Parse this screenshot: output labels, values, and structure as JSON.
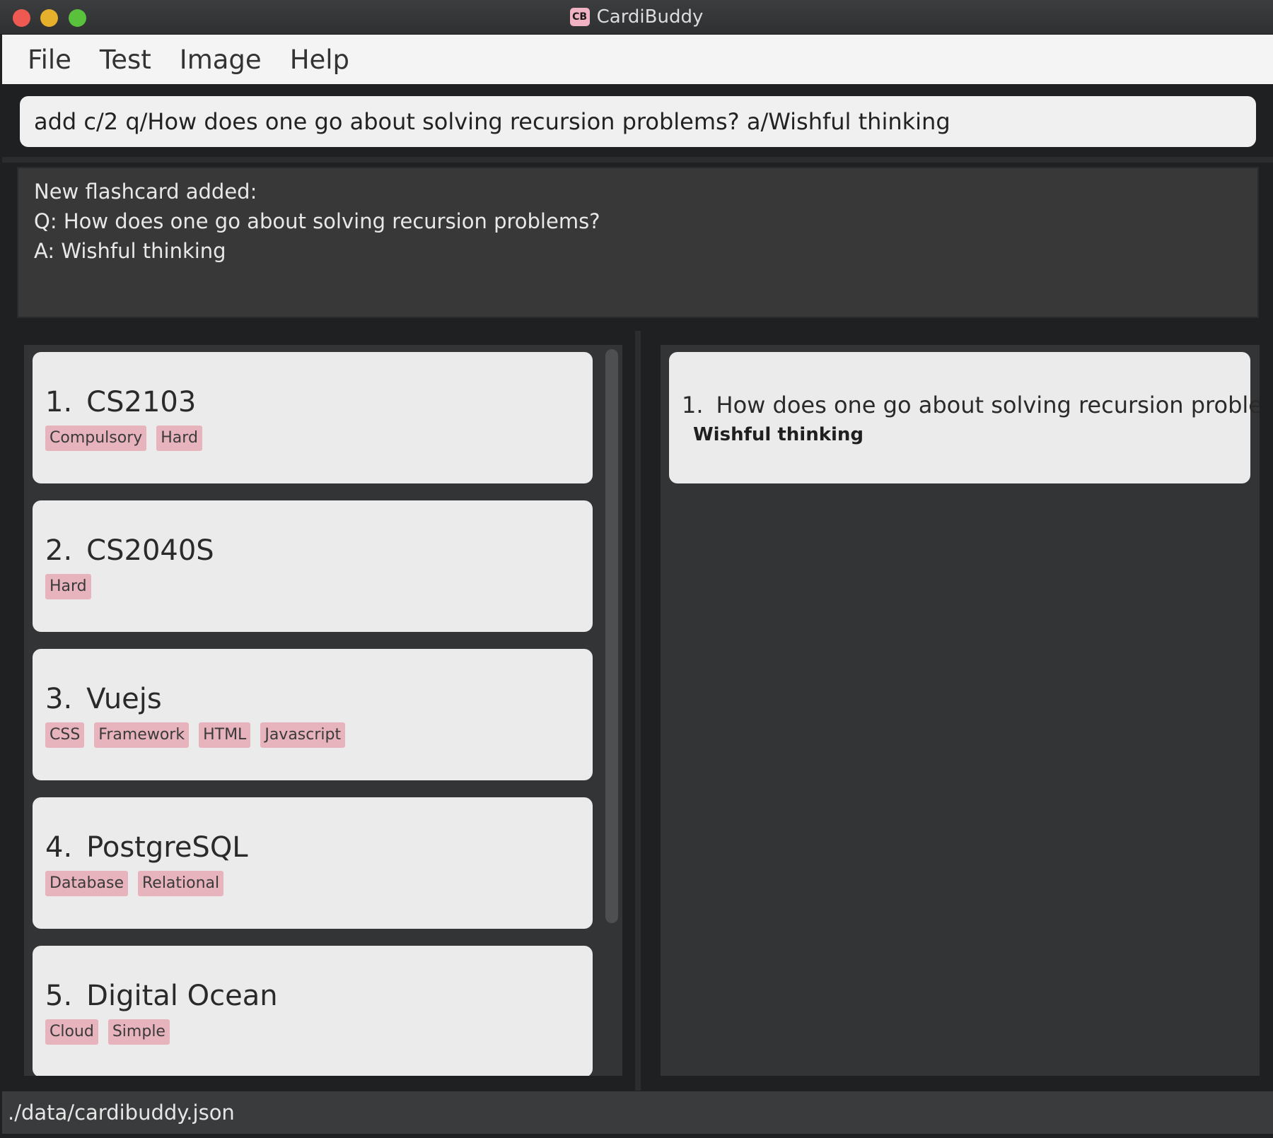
{
  "window": {
    "title": "CardiBuddy",
    "logo_text": "CB"
  },
  "menu": [
    "File",
    "Test",
    "Image",
    "Help"
  ],
  "command": {
    "value": "add c/2 q/How does one go about solving recursion problems? a/Wishful thinking"
  },
  "result": {
    "lines": [
      "New flashcard added:",
      "Q: How does one go about solving recursion problems?",
      "A: Wishful thinking"
    ]
  },
  "decks": [
    {
      "index": "1.",
      "name": "CS2103",
      "tags": [
        "Compulsory",
        "Hard"
      ]
    },
    {
      "index": "2.",
      "name": "CS2040S",
      "tags": [
        "Hard"
      ]
    },
    {
      "index": "3.",
      "name": "Vuejs",
      "tags": [
        "CSS",
        "Framework",
        "HTML",
        "Javascript"
      ]
    },
    {
      "index": "4.",
      "name": "PostgreSQL",
      "tags": [
        "Database",
        "Relational"
      ]
    },
    {
      "index": "5.",
      "name": "Digital Ocean",
      "tags": [
        "Cloud",
        "Simple"
      ]
    }
  ],
  "flashcards": [
    {
      "index": "1.",
      "question": "How does one go about solving recursion problems?",
      "answer": "Wishful thinking"
    }
  ],
  "status": {
    "file_path": "./data/cardibuddy.json"
  },
  "colors": {
    "tag_bg": "#e7b3bd",
    "panel_bg": "#333436",
    "card_bg": "#ebebeb"
  }
}
